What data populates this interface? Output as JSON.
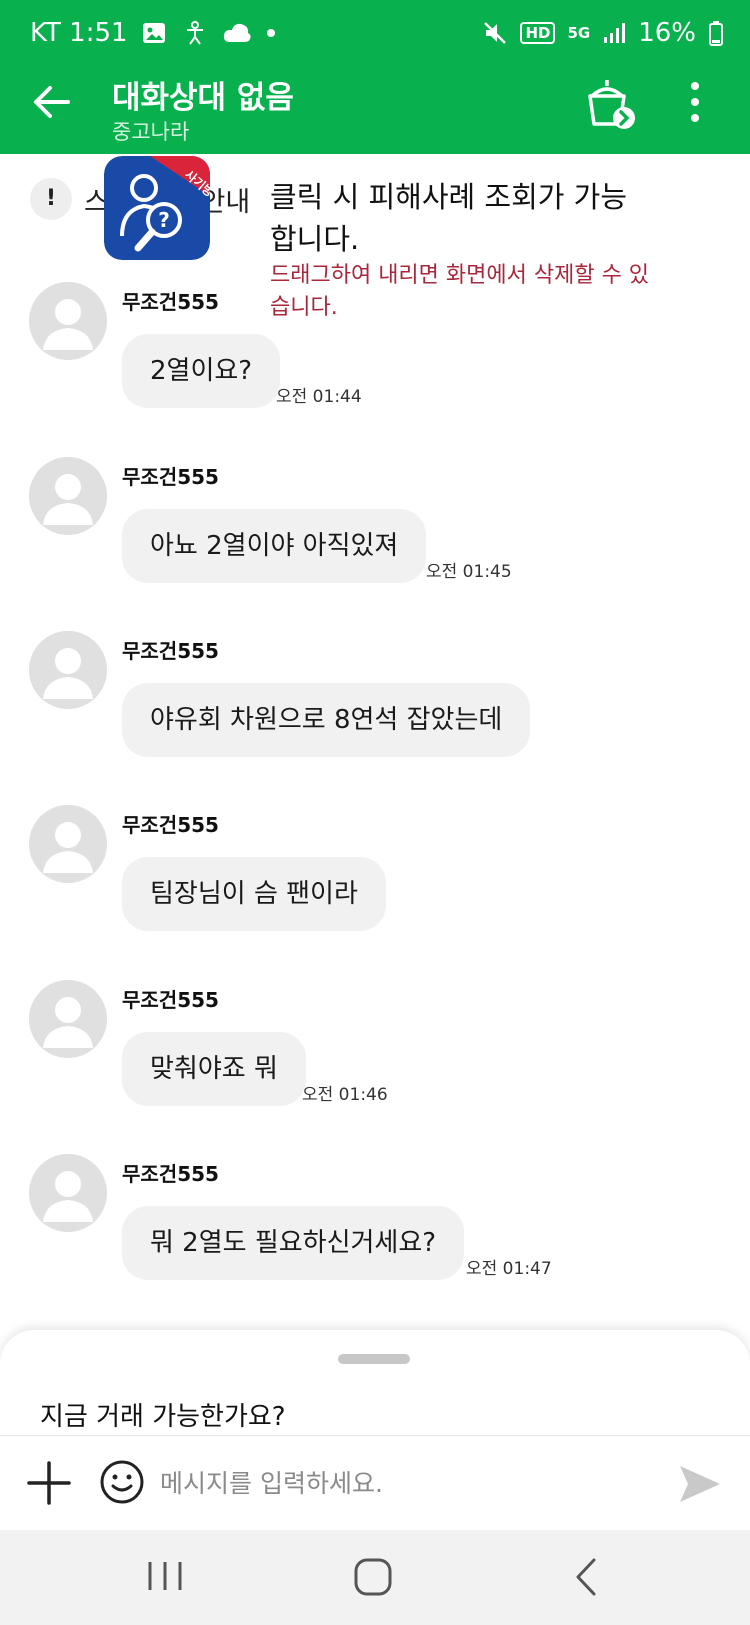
{
  "status_bar": {
    "carrier_time": "KT 1:51",
    "network": "5G",
    "hd": "HD",
    "battery": "16%",
    "icons": [
      "image-icon",
      "accessibility-icon",
      "cloud-icon",
      "dot-icon",
      "mute-icon",
      "signal-icon",
      "battery-icon"
    ]
  },
  "header": {
    "title": "대화상대 없음",
    "subtitle": "중고나라",
    "icons": [
      "back-arrow-icon",
      "leave-chat-icon",
      "more-icon"
    ],
    "bg_color": "#08b14e"
  },
  "notice": {
    "text": "스팸 신고 안내",
    "icon": "exclamation-icon"
  },
  "scam_popup": {
    "badge_text": "사기방지",
    "title": "클릭 시 피해사례 조회가 가능합니다.",
    "subtitle": "드래그하여 내리면 화면에서 삭제할 수 있습니다.",
    "subtitle_color": "#a8273a"
  },
  "messages": [
    {
      "sender": "무조건555",
      "text": "2열이요?",
      "time": "오전 01:44"
    },
    {
      "sender": "무조건555",
      "text": "아뇨 2열이야 아직있져",
      "time": "오전 01:45"
    },
    {
      "sender": "무조건555",
      "text": "야유회 차원으로 8연석 잡았는데",
      "time": ""
    },
    {
      "sender": "무조건555",
      "text": "팀장님이 슴 팬이라",
      "time": ""
    },
    {
      "sender": "무조건555",
      "text": "맞춰야죠 뭐",
      "time": "오전 01:46"
    },
    {
      "sender": "무조건555",
      "text": "뭐 2열도 필요하신거세요?",
      "time": "오전 01:47"
    }
  ],
  "quick_reply_sheet": {
    "suggestion": "지금 거래 가능한가요?"
  },
  "input_bar": {
    "placeholder": "메시지를 입력하세요.",
    "icons": [
      "plus-icon",
      "emoji-icon",
      "send-icon"
    ]
  },
  "nav_bar": {
    "icons": [
      "recent-apps-icon",
      "home-icon",
      "back-icon"
    ]
  }
}
